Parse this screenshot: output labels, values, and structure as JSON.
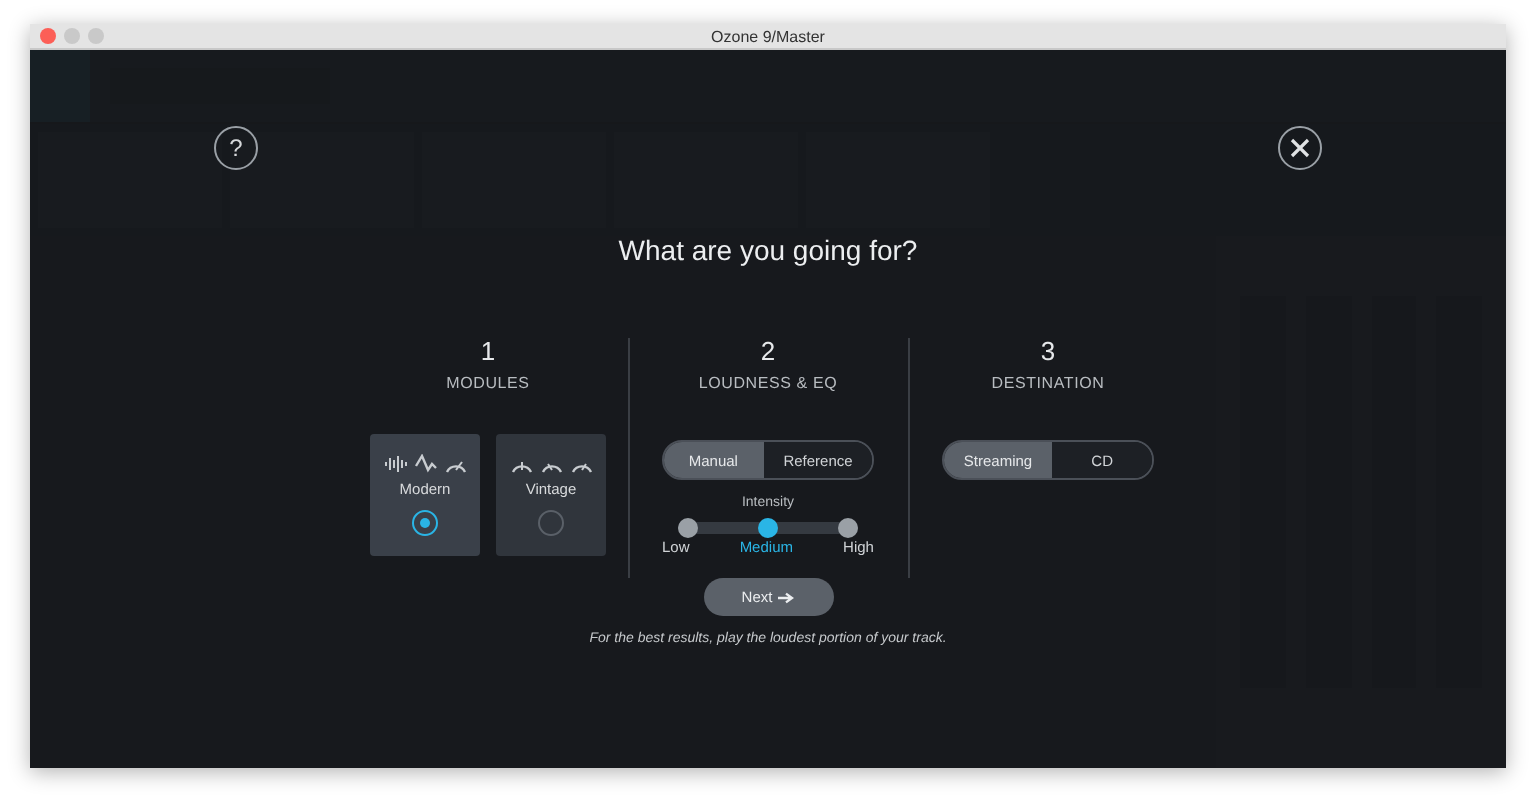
{
  "window": {
    "title": "Ozone 9/Master"
  },
  "wizard": {
    "help": "?",
    "title": "What are you going for?",
    "steps": [
      {
        "kind": "modules",
        "number": "1",
        "label": "MODULES",
        "options": [
          {
            "label": "Modern",
            "selected": true
          },
          {
            "label": "Vintage",
            "selected": false
          }
        ]
      },
      {
        "kind": "loudness",
        "number": "2",
        "label": "LOUDNESS & EQ",
        "segments": [
          {
            "label": "Manual",
            "selected": true
          },
          {
            "label": "Reference",
            "selected": false
          }
        ],
        "intensity": {
          "label": "Intensity",
          "options": [
            {
              "label": "Low",
              "selected": false
            },
            {
              "label": "Medium",
              "selected": true
            },
            {
              "label": "High",
              "selected": false
            }
          ]
        }
      },
      {
        "kind": "destination",
        "number": "3",
        "label": "DESTINATION",
        "segments": [
          {
            "label": "Streaming",
            "selected": true
          },
          {
            "label": "CD",
            "selected": false
          }
        ]
      }
    ],
    "next": "Next",
    "hint": "For the best results, play the loudest portion of your track."
  }
}
